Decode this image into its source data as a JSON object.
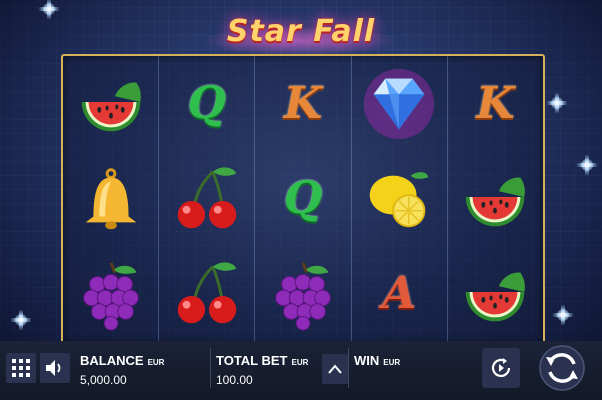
{
  "game": {
    "title": "Star Fall"
  },
  "reels": [
    [
      "watermelon",
      "bell",
      "grapes"
    ],
    [
      "Q",
      "cherries",
      "cherries"
    ],
    [
      "K",
      "Q",
      "grapes"
    ],
    [
      "diamond",
      "lemon",
      "A"
    ],
    [
      "K",
      "watermelon",
      "watermelon"
    ]
  ],
  "bottom_bar": {
    "balance": {
      "label": "BALANCE",
      "currency": "EUR",
      "value": "5,000.00"
    },
    "total_bet": {
      "label": "TOTAL BET",
      "currency": "EUR",
      "value": "100.00"
    },
    "win": {
      "label": "WIN",
      "currency": "EUR",
      "value": ""
    }
  },
  "icons": {
    "menu": "grid-icon",
    "sound": "speaker-icon",
    "bet_up": "chevron-up-icon",
    "autoplay": "autoplay-icon",
    "spin": "spin-icon"
  }
}
